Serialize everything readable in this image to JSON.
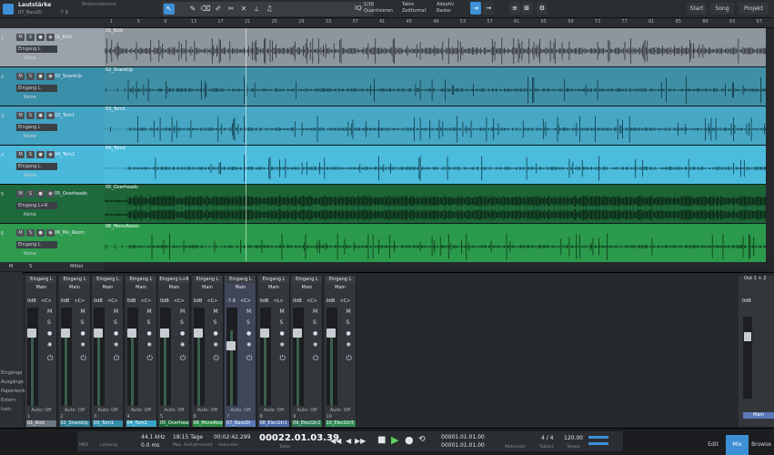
{
  "header": {
    "title": "Lautstärke",
    "subtitle": "07_BassDI",
    "db": "-7.9",
    "section": "Bedienelement",
    "quantize": {
      "value": "1/16",
      "label": "Quantisieren"
    },
    "timebase": {
      "value": "Takte",
      "label": "Zeitformat"
    },
    "snap": {
      "value": "Adaptiv",
      "label": "Raster"
    },
    "buttons": {
      "start": "Start",
      "song": "Song",
      "project": "Projekt"
    }
  },
  "ruler": {
    "marks": [
      "1",
      "5",
      "9",
      "13",
      "17",
      "21",
      "25",
      "29",
      "33",
      "37",
      "41",
      "45",
      "49",
      "53",
      "57",
      "61",
      "65",
      "69",
      "73",
      "77",
      "81",
      "85",
      "89",
      "93",
      "97"
    ]
  },
  "tracks": [
    {
      "num": "1",
      "name": "01_Kick",
      "input": "Eingang L",
      "output": "Keine",
      "clip": "01_Kick",
      "color": "#9aa3ab",
      "lane": "#8e969d",
      "wave": "#2b3034"
    },
    {
      "num": "2",
      "name": "02_SnareUp",
      "input": "Eingang L",
      "output": "Keine",
      "clip": "02_SnareUp",
      "color": "#3a8ea8",
      "lane": "#3f90a6",
      "wave": "#10323d"
    },
    {
      "num": "3",
      "name": "03_Tom1",
      "input": "Eingang L",
      "output": "Keine",
      "clip": "03_Tom1",
      "color": "#43a3c2",
      "lane": "#47a7c4",
      "wave": "#0f3a48"
    },
    {
      "num": "4",
      "name": "04_Tom2",
      "input": "Eingang L",
      "output": "Keine",
      "clip": "04_Tom2",
      "color": "#4ab8da",
      "lane": "#4cbcdd",
      "wave": "#0d3b4a"
    },
    {
      "num": "5",
      "name": "05_Overheads",
      "input": "Eingang L+R",
      "output": "Keine",
      "clip": "05_Overheads",
      "color": "#1f6a3c",
      "lane": "#1d6437",
      "wave": "#08200f"
    },
    {
      "num": "6",
      "name": "06_Mo_Room",
      "input": "Eingang L",
      "output": "Keine",
      "clip": "06_MonoRoom",
      "color": "#2e9b4e",
      "lane": "#2c9a4c",
      "wave": "#0a3517"
    }
  ],
  "mixbar": {
    "m": "M",
    "s": "S",
    "mittel": "Mittel"
  },
  "mixer_left": [
    "Eingänge",
    "Ausgänge",
    "Papierkorb",
    "Extern",
    "Instr."
  ],
  "channels": [
    {
      "in": "Eingang L",
      "out": "Main",
      "db": "0dB",
      "pan": "<C>",
      "num": "1",
      "name": "01_Kick",
      "color": "#6d7780"
    },
    {
      "in": "Eingang L",
      "out": "Main",
      "db": "0dB",
      "pan": "<C>",
      "num": "2",
      "name": "02_SnareUp",
      "color": "#2f7f96"
    },
    {
      "in": "Eingang L",
      "out": "Main",
      "db": "0dB",
      "pan": "<C>",
      "num": "3",
      "name": "03_Tom1",
      "color": "#358fab"
    },
    {
      "in": "Eingang L",
      "out": "Main",
      "db": "0dB",
      "pan": "<C>",
      "num": "4",
      "name": "04_Tom2",
      "color": "#3aa3c5"
    },
    {
      "in": "Eingang L+R",
      "out": "Main",
      "db": "0dB",
      "pan": "<C>",
      "num": "5",
      "name": "05_Overheads",
      "color": "#1f6a3c"
    },
    {
      "in": "Eingang L",
      "out": "Main",
      "db": "0dB",
      "pan": "<C>",
      "num": "6",
      "name": "06_MonoRoom",
      "color": "#2a8a45"
    },
    {
      "in": "Eingang L",
      "out": "Main",
      "db": "-7.9",
      "pan": "<C>",
      "num": "7",
      "name": "07_BassDI",
      "color": "#5a7ab8"
    },
    {
      "in": "Eingang L",
      "out": "Main",
      "db": "0dB",
      "pan": "<L>",
      "num": "8",
      "name": "08_ElecGtr1",
      "color": "#4a6aa8"
    },
    {
      "in": "Eingang L",
      "out": "Main",
      "db": "0dB",
      "pan": "<C>",
      "num": "9",
      "name": "09_ElecGtr2",
      "color": "#2f7a55"
    },
    {
      "in": "Eingang L",
      "out": "Main",
      "db": "0dB",
      "pan": "<C>",
      "num": "10",
      "name": "10_ElecGtr3",
      "color": "#2e8a52"
    }
  ],
  "strip_labels": {
    "m": "M",
    "s": "S",
    "auto": "Auto: Off"
  },
  "master": {
    "in": "Out 1 + 2",
    "db": "0dB",
    "name": "Main"
  },
  "transport": {
    "midi": "MIDI",
    "perf": "Leistung",
    "rate": "44.1 kHz",
    "latency": "0.0 ms",
    "days": "18:15 Tage",
    "days_label": "Max. Aufnahmezeit",
    "seconds": "00:02:42.299",
    "seconds_label": "Sekunden",
    "bars": "00022.01.03.39",
    "bars_label": "Takte",
    "loop_l": "00001.01.01.00",
    "loop_r": "00001.01.01.00",
    "metronome": "Metronom",
    "sig": "4 / 4",
    "sig_label": "Taktart",
    "tempo": "120.00",
    "tempo_label": "Tempo"
  },
  "views": {
    "edit": "Edit",
    "mix": "Mix",
    "browse": "Browse"
  }
}
